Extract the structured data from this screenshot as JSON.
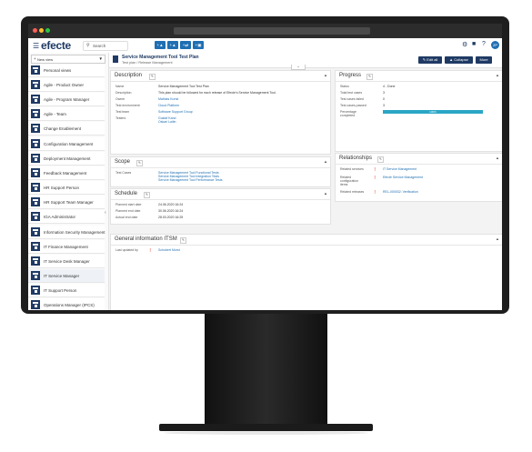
{
  "app": {
    "logo": "efecte",
    "search_placeholder": "Search",
    "brand_color": "#1f3a64",
    "accent_color": "#1f6fb2",
    "avatar_initials": "ZP"
  },
  "toolbar": {
    "add_buttons": [
      "+",
      "+",
      "+",
      "+"
    ]
  },
  "sidebar": {
    "new_view": "New view",
    "items": [
      {
        "label": "Personal views"
      },
      {
        "label": "Agile - Product Owner"
      },
      {
        "label": "Agile - Program Manager"
      },
      {
        "label": "Agile - Team"
      },
      {
        "label": "Change Enablement"
      },
      {
        "label": "Configuration Management"
      },
      {
        "label": "Deployment Management"
      },
      {
        "label": "Feedback Management"
      },
      {
        "label": "HR Support Person"
      },
      {
        "label": "HR Support Team Manager"
      },
      {
        "label": "IGA Administrator"
      },
      {
        "label": "Information Security Management"
      },
      {
        "label": "IT Finance Management"
      },
      {
        "label": "IT Service Desk Manager"
      },
      {
        "label": "IT Service Manager"
      },
      {
        "label": "IT Support Person"
      },
      {
        "label": "Operations Manager (IPCS)"
      }
    ]
  },
  "page": {
    "title": "Service Management Tool Test Plan",
    "subtitle": "Test plan / Release Management",
    "buttons": {
      "edit": "Edit all",
      "collapse": "Collapse",
      "more": "More"
    }
  },
  "description": {
    "heading": "Description",
    "rows": [
      {
        "k": "Name",
        "v": "Service Management Tool Test Plan",
        "link": false
      },
      {
        "k": "Description",
        "v": "This plan should be followed for each release of Efecte's Service Management Tool.",
        "link": false
      },
      {
        "k": "Owner",
        "v": "Mathias Kunst",
        "link": true
      },
      {
        "k": "Test environment",
        "v": "Cloud Platform",
        "link": true
      },
      {
        "k": "Test team",
        "v": "Software Support Group",
        "link": true
      },
      {
        "k": "Testers",
        "v": "Gustaf Kand",
        "v2": "Oskari Laitin",
        "link": true
      }
    ]
  },
  "scope": {
    "heading": "Scope",
    "label": "Test Cases",
    "items": [
      "Service Management Tool Functional Tests",
      "Service Management Tool Integration Tests",
      "Service Management Tool Performance Tests"
    ]
  },
  "schedule": {
    "heading": "Schedule",
    "rows": [
      {
        "k": "Planned start date",
        "v": "24.06.2020 16:24"
      },
      {
        "k": "Planned end date",
        "v": "30.06.2020 16:24"
      },
      {
        "k": "Actual end date",
        "v": "28.03.2020 16:25"
      }
    ]
  },
  "progress": {
    "heading": "Progress",
    "rows": [
      {
        "k": "Status",
        "v": "4 - Done"
      },
      {
        "k": "Total test cases",
        "v": "3"
      },
      {
        "k": "Test cases failed",
        "v": "0"
      },
      {
        "k": "Test cases passed",
        "v": "3"
      }
    ],
    "percentage_label": "Percentage",
    "percentage_label2": "completed",
    "percentage_value": 1.0,
    "percentage_text": "100%"
  },
  "relationships": {
    "heading": "Relationships",
    "rows": [
      {
        "k": "Related services",
        "v": "IT Service Management"
      },
      {
        "k": "Related",
        "k2": "configuration",
        "k3": "items",
        "v": "Efecte Service Management"
      },
      {
        "k": "Related releases",
        "v": "REL-000032: Verification"
      }
    ]
  },
  "general": {
    "heading": "General information ITSM",
    "row": {
      "k": "Last updated by",
      "v": "Schubert Morst"
    }
  }
}
